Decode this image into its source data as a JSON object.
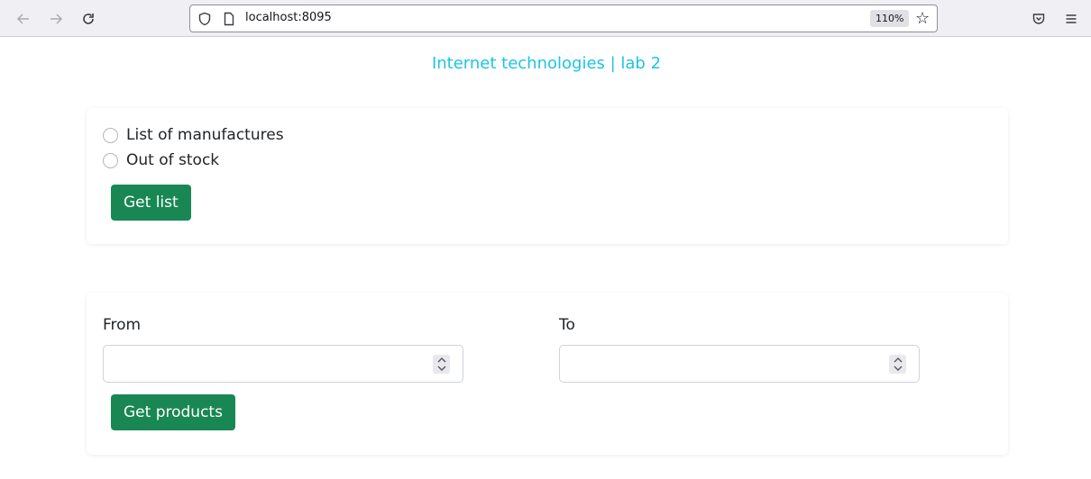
{
  "browser": {
    "url": "localhost:8095",
    "zoom": "110%",
    "icons": {
      "back": "arrow-left-icon",
      "forward": "arrow-right-icon",
      "reload": "reload-icon",
      "shield": "tracking-protection-icon",
      "page": "page-icon",
      "bookmark": "star-icon",
      "pocket": "pocket-icon",
      "menu": "hamburger-menu-icon"
    }
  },
  "page": {
    "title": "Internet technologies | lab 2"
  },
  "list_card": {
    "options": [
      {
        "label": "List of manufactures",
        "checked": false
      },
      {
        "label": "Out of stock",
        "checked": false
      }
    ],
    "button_label": "Get list"
  },
  "range_card": {
    "from_label": "From",
    "from_value": "",
    "to_label": "To",
    "to_value": "",
    "button_label": "Get products"
  },
  "colors": {
    "title": "#1ec4e4",
    "button": "#198754"
  }
}
